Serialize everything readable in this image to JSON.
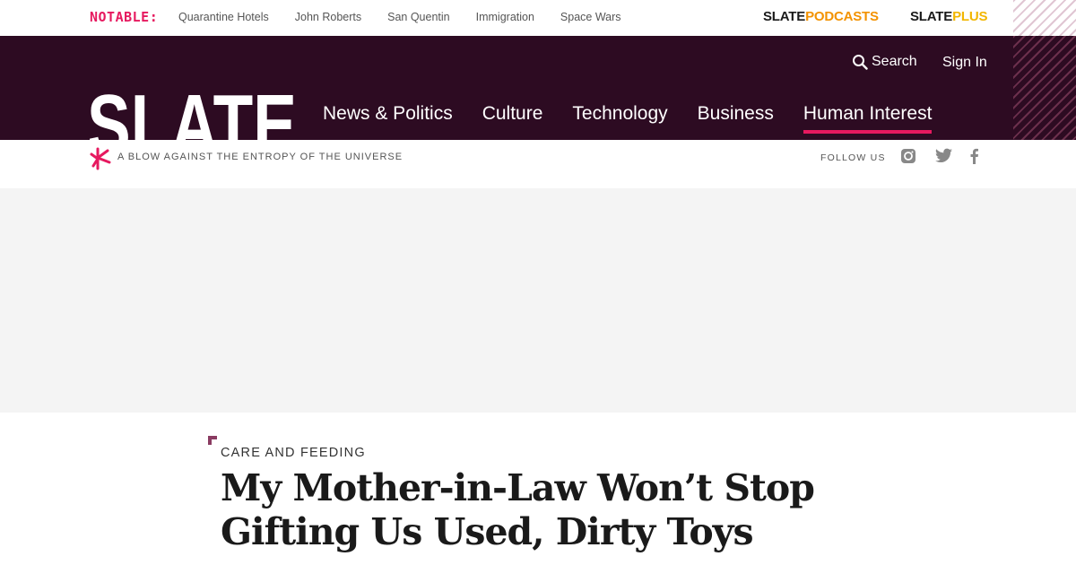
{
  "topbar": {
    "notable_label": "NOTABLE:",
    "links": [
      "Quarantine Hotels",
      "John Roberts",
      "San Quentin",
      "Immigration",
      "Space Wars"
    ],
    "podcasts_brand": "SLATE",
    "podcasts_label": "PODCASTS",
    "plus_brand": "SLATE",
    "plus_label": "PLUS"
  },
  "header": {
    "logo_text": "SLATE",
    "search_label": "Search",
    "signin_label": "Sign In",
    "nav": [
      "News & Politics",
      "Culture",
      "Technology",
      "Business",
      "Human Interest"
    ],
    "active_nav": "Human Interest"
  },
  "tagrow": {
    "tagline": "A BLOW AGAINST THE ENTROPY OF THE UNIVERSE",
    "follow_label": "FOLLOW US",
    "social_icons": [
      "instagram-icon",
      "twitter-icon",
      "facebook-icon"
    ]
  },
  "article": {
    "kicker": "CARE AND FEEDING",
    "headline": "My Mother-in-Law Won’t Stop Gifting Us Used, Dirty Toys"
  },
  "colors": {
    "header_bg": "#2d0b22",
    "accent": "#e6195f",
    "podcasts": "#f39200",
    "plus": "#f2b600"
  }
}
